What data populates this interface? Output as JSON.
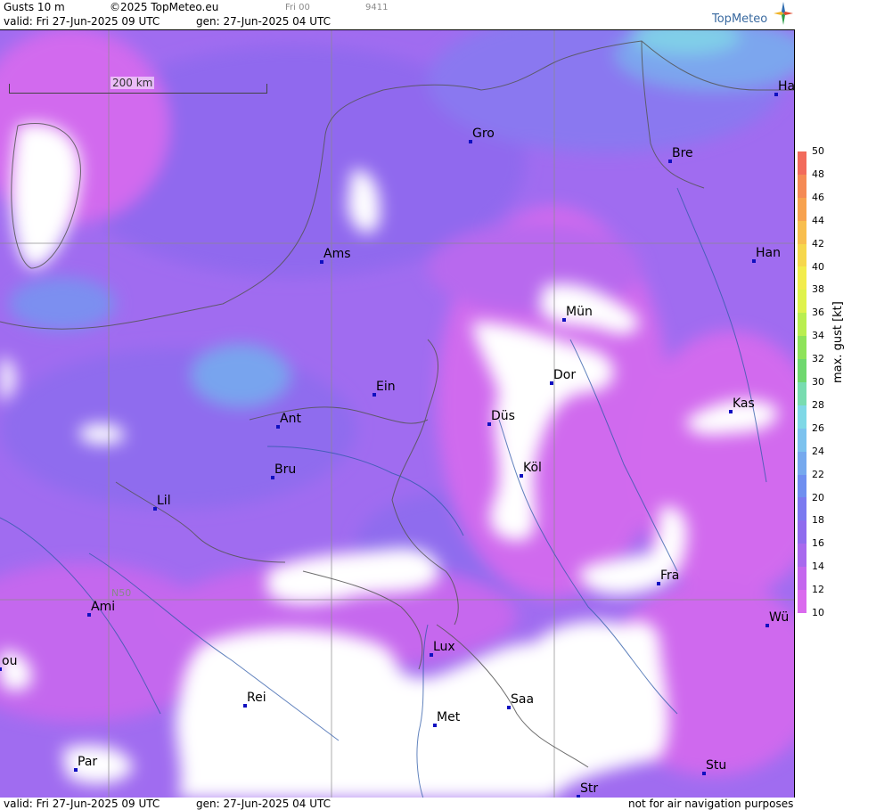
{
  "header": {
    "product": "Gusts 10 m",
    "copyright": "©2025 TopMeteo.eu",
    "ref_run": "Fri 00",
    "code": "9411",
    "valid": "valid:  Fri  27-Jun-2025  09 UTC",
    "gen": "gen:  27-Jun-2025  04 UTC",
    "logo": "TopMeteo"
  },
  "footer": {
    "valid": "valid:  Fri  27-Jun-2025  09 UTC",
    "gen": "gen:  27-Jun-2025  04 UTC",
    "disclaimer": "not for air navigation purposes"
  },
  "map": {
    "scale_label": "200 km",
    "lat_label": "N50",
    "cities": [
      {
        "name": "Ha"
      },
      {
        "name": "Gro"
      },
      {
        "name": "Bre"
      },
      {
        "name": "Ams"
      },
      {
        "name": "Han"
      },
      {
        "name": "Mün"
      },
      {
        "name": "Dor"
      },
      {
        "name": "Ein"
      },
      {
        "name": "Kas"
      },
      {
        "name": "Düs"
      },
      {
        "name": "Ant"
      },
      {
        "name": "Köl"
      },
      {
        "name": "Bru"
      },
      {
        "name": "Lil"
      },
      {
        "name": "Fra"
      },
      {
        "name": "Ami"
      },
      {
        "name": "Wü"
      },
      {
        "name": "Lux"
      },
      {
        "name": "ou"
      },
      {
        "name": "Rei"
      },
      {
        "name": "Saa"
      },
      {
        "name": "Met"
      },
      {
        "name": "Par"
      },
      {
        "name": "Stu"
      },
      {
        "name": "Str"
      }
    ]
  },
  "legend": {
    "title": "max. gust [kt]",
    "ticks": [
      "50",
      "48",
      "46",
      "44",
      "42",
      "40",
      "38",
      "36",
      "34",
      "32",
      "30",
      "28",
      "26",
      "24",
      "22",
      "20",
      "18",
      "16",
      "14",
      "12",
      "10"
    ],
    "colors": [
      "#f26b5c",
      "#f58a55",
      "#f7a24f",
      "#f8be4e",
      "#f6d74c",
      "#f2ec4c",
      "#dff24c",
      "#b9ee50",
      "#8ee35a",
      "#6fd86f",
      "#78dcb0",
      "#7fd8e6",
      "#7cc2ee",
      "#76a9ee",
      "#6f8ff0",
      "#7b7af0",
      "#8f6cee",
      "#a869ee",
      "#c467ee",
      "#da6aee"
    ]
  }
}
